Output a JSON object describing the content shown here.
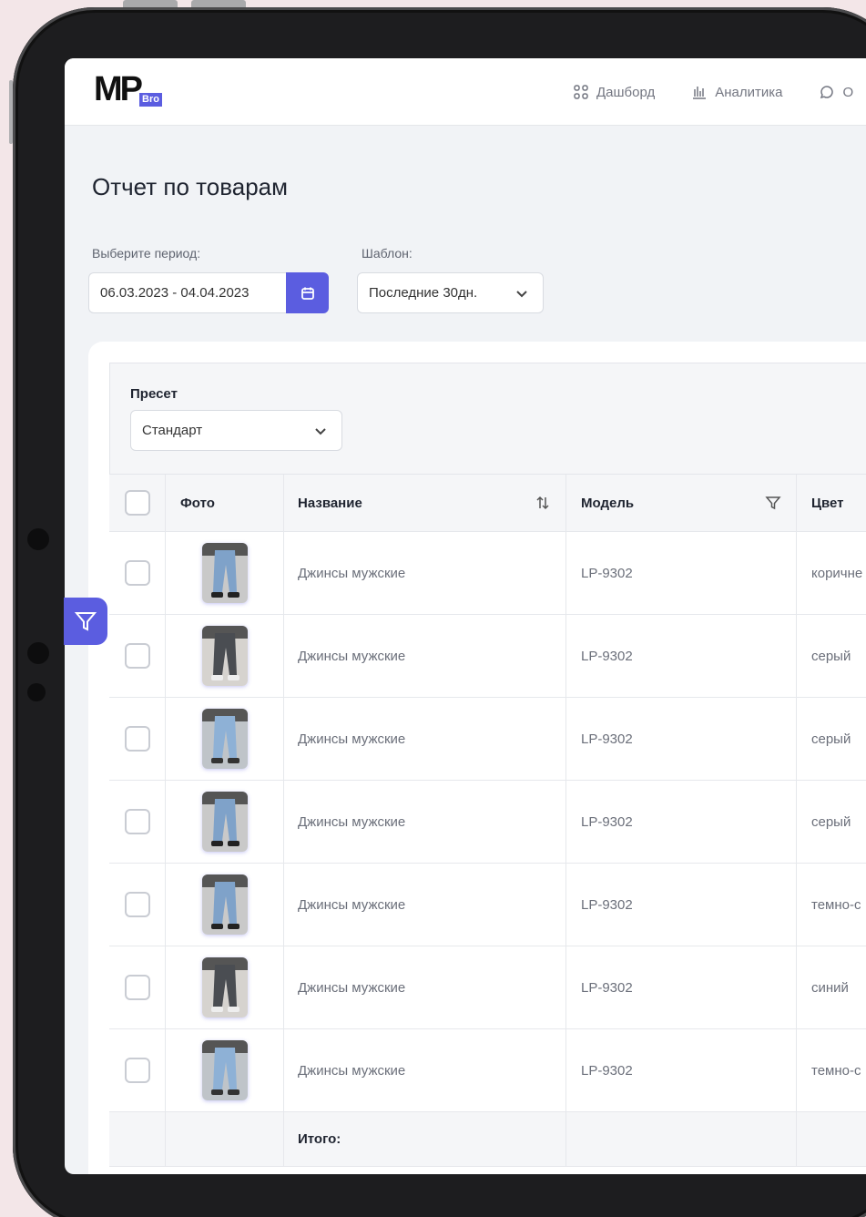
{
  "logo": {
    "text": "MP",
    "badge": "Bro"
  },
  "nav": {
    "items": [
      {
        "label": "Дашборд",
        "icon": "dashboard-grid-icon"
      },
      {
        "label": "Аналитика",
        "icon": "bar-chart-icon"
      },
      {
        "label": "О",
        "icon": "chat-icon"
      }
    ]
  },
  "page": {
    "title": "Отчет по товарам"
  },
  "filters": {
    "period_label": "Выберите период:",
    "period_value": "06.03.2023 - 04.04.2023",
    "template_label": "Шаблон:",
    "template_value": "Последние 30дн."
  },
  "preset": {
    "label": "Пресет",
    "value": "Стандарт"
  },
  "table": {
    "headers": {
      "photo": "Фото",
      "name": "Название",
      "model": "Модель",
      "color": "Цвет"
    },
    "rows": [
      {
        "name": "Джинсы мужские",
        "model": "LP-9302",
        "color": "коричне"
      },
      {
        "name": "Джинсы  мужские",
        "model": "LP-9302",
        "color": "серый"
      },
      {
        "name": "Джинсы мужские",
        "model": "LP-9302",
        "color": "серый"
      },
      {
        "name": "Джинсы мужские",
        "model": "LP-9302",
        "color": "серый"
      },
      {
        "name": "Джинсы мужские",
        "model": "LP-9302",
        "color": "темно-с"
      },
      {
        "name": "Джинсы мужские",
        "model": "LP-9302",
        "color": "синий"
      },
      {
        "name": "Джинсы мужские",
        "model": "LP-9302",
        "color": "темно-с"
      }
    ],
    "total_label": "Итого:"
  },
  "colors": {
    "accent": "#5b5de0",
    "background": "#f1f3f6",
    "frame": "#1d1d1f"
  }
}
